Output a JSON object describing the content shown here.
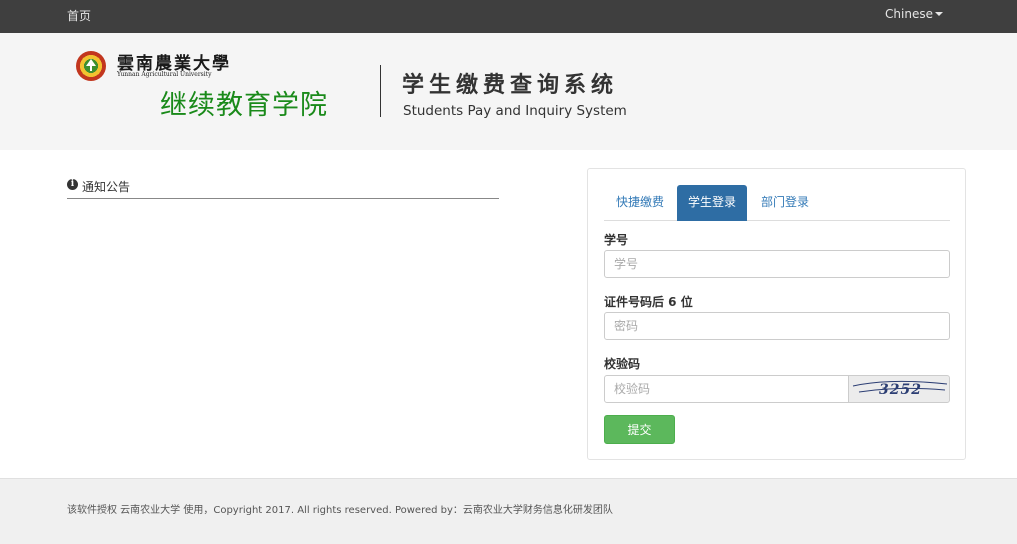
{
  "nav": {
    "home": "首页",
    "language": "Chinese"
  },
  "header": {
    "university_cn": "雲南農業大學",
    "university_en": "Yunnan Agricultural University",
    "college": "继续教育学院",
    "system_title": "学生缴费查询系统",
    "system_title_en": "Students Pay and Inquiry System"
  },
  "notice": {
    "icon": "info-icon",
    "label": "通知公告"
  },
  "login": {
    "tabs": [
      "快捷缴费",
      "学生登录",
      "部门登录"
    ],
    "active_tab": "学生登录",
    "student_id": {
      "label": "学号",
      "placeholder": "学号",
      "value": ""
    },
    "id_last6": {
      "label": "证件号码后 6 位",
      "placeholder": "密码",
      "value": ""
    },
    "captcha": {
      "label": "校验码",
      "placeholder": "校验码",
      "value": "",
      "image_text": "3252"
    },
    "submit": "提交"
  },
  "footer": {
    "text": "该软件授权 云南农业大学 使用，Copyright 2017. All rights reserved. Powered by：云南农业大学财务信息化研发团队"
  },
  "colors": {
    "topbar": "#3f3f3f",
    "active_tab": "#2e6da4",
    "submit": "#5cb85c",
    "college": "#1a8a1a"
  }
}
